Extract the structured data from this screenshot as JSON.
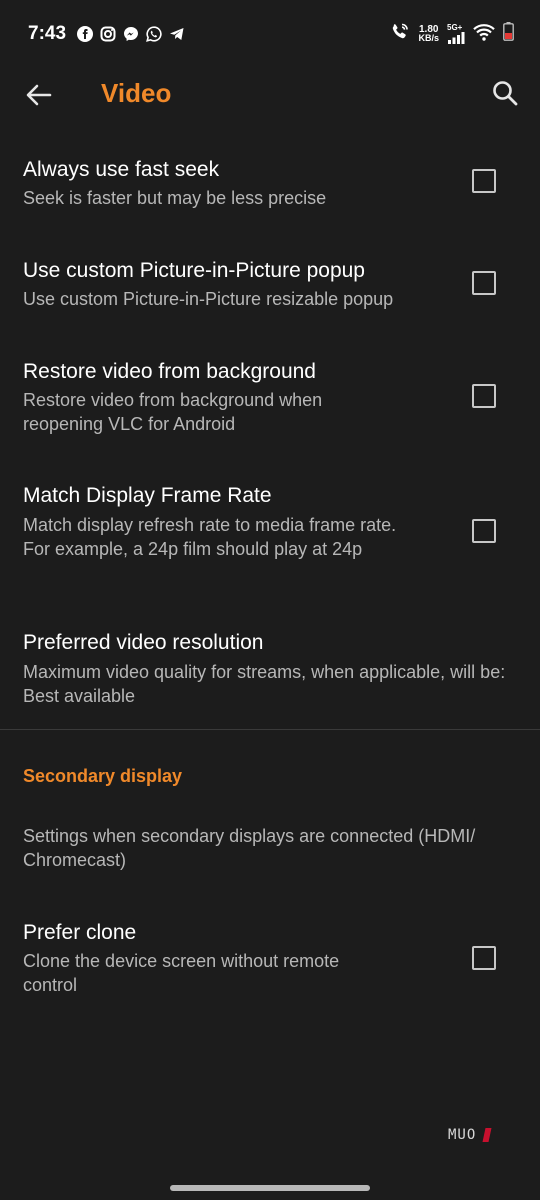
{
  "status_bar": {
    "time": "7:43",
    "notification_icons": [
      "facebook-icon",
      "instagram-icon",
      "messenger-icon",
      "whatsapp-icon",
      "telegram-icon"
    ],
    "net_speed_value": "1.80",
    "net_speed_unit": "KB/s",
    "network_type": "5G+",
    "battery_color": "#e53935"
  },
  "toolbar": {
    "title": "Video",
    "accent_color": "#f0892a"
  },
  "preferences": [
    {
      "title": "Always use fast seek",
      "summary": "Seek is faster but may be less precise",
      "has_checkbox": true,
      "checked": false
    },
    {
      "title": "Use custom Picture-in-Picture popup",
      "summary": "Use custom Picture-in-Picture resizable popup",
      "has_checkbox": true,
      "checked": false
    },
    {
      "title": "Restore video from background",
      "summary": "Restore video from background when reopening VLC for Android",
      "has_checkbox": true,
      "checked": false
    },
    {
      "title": "Match Display Frame Rate",
      "summary": "Match display refresh rate to media frame rate. For example, a 24p film should play at 24p",
      "has_checkbox": true,
      "checked": false
    },
    {
      "title": "Preferred video resolution",
      "summary": "Maximum video quality for streams, when applicable, will be: Best available",
      "has_checkbox": false
    }
  ],
  "secondary_display": {
    "category_title": "Secondary display",
    "info_text": "Settings when secondary displays are connected (HDMI/ Chromecast)",
    "pref_title": "Prefer clone",
    "pref_summary": "Clone the device screen without remote control",
    "checked": false
  },
  "watermark": "MUO"
}
